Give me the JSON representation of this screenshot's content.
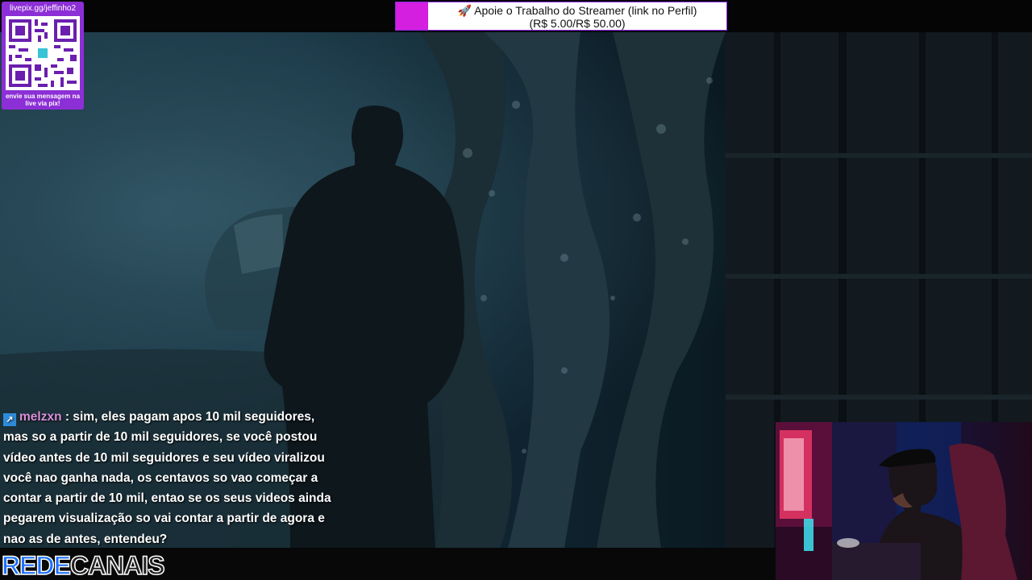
{
  "donation": {
    "line1": "🚀 Apoie o Trabalho do Streamer (link no Perfil)",
    "line2": "(R$ 5.00/R$ 50.00)",
    "accent_color": "#d41ee0"
  },
  "qr_panel": {
    "url": "livepix.gg/jeffinho2",
    "message": "envie sua mensagem na live via pix!",
    "color": "#8c2fd6"
  },
  "chat": {
    "username": "melzxn",
    "separator": ":",
    "message": "sim, eles pagam apos 10 mil seguidores, mas so a partir de 10 mil seguidores, se você postou vídeo antes de 10 mil seguidores e seu vídeo viralizou você nao ganha nada, os centavos so vao começar a contar a partir de 10 mil, entao se os seus videos ainda pegarem visualização so vai contar a partir de agora e nao as de antes, entendeu?",
    "badge_icon": "prime-badge-icon",
    "username_color": "#d98fd8"
  },
  "logo": {
    "part1": "REDE",
    "part2": "CANAIS"
  }
}
